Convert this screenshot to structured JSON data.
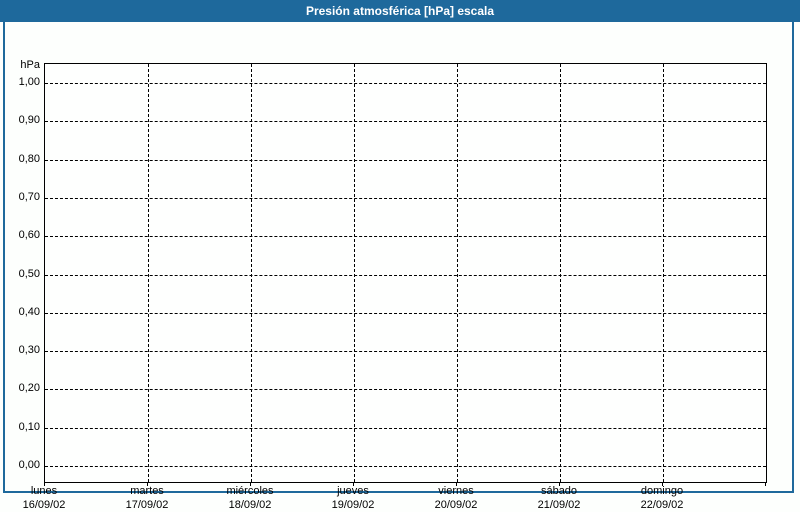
{
  "window": {
    "title": "Presión atmosférica [hPa] escala"
  },
  "colors": {
    "titlebar_bg": "#1e699c",
    "titlebar_text": "#ffffff",
    "frame_border": "#1e699c",
    "page_bg": "#fdfffd",
    "plot_bg": "#fefffe",
    "grid": "#000000",
    "label_text": "#000000"
  },
  "chart_data": {
    "type": "line",
    "title": "Presión atmosférica [hPa] escala",
    "ylabel": "hPa",
    "ylim": [
      0.0,
      1.0
    ],
    "y_tick_values": [
      1.0,
      0.9,
      0.8,
      0.7,
      0.6,
      0.5,
      0.4,
      0.3,
      0.2,
      0.1,
      0.0
    ],
    "y_tick_labels": [
      "1,00",
      "0,90",
      "0,80",
      "0,70",
      "0,60",
      "0,50",
      "0,40",
      "0,30",
      "0,20",
      "0,10",
      "0,00"
    ],
    "categories": [
      {
        "day": "lunes",
        "date": "16/09/02"
      },
      {
        "day": "martes",
        "date": "17/09/02"
      },
      {
        "day": "miércoles",
        "date": "18/09/02"
      },
      {
        "day": "jueves",
        "date": "19/09/02"
      },
      {
        "day": "viernes",
        "date": "20/09/02"
      },
      {
        "day": "sábado",
        "date": "21/09/02"
      },
      {
        "day": "domingo",
        "date": "22/09/02"
      }
    ],
    "series": [],
    "grid": "dashed",
    "legend": "none"
  }
}
